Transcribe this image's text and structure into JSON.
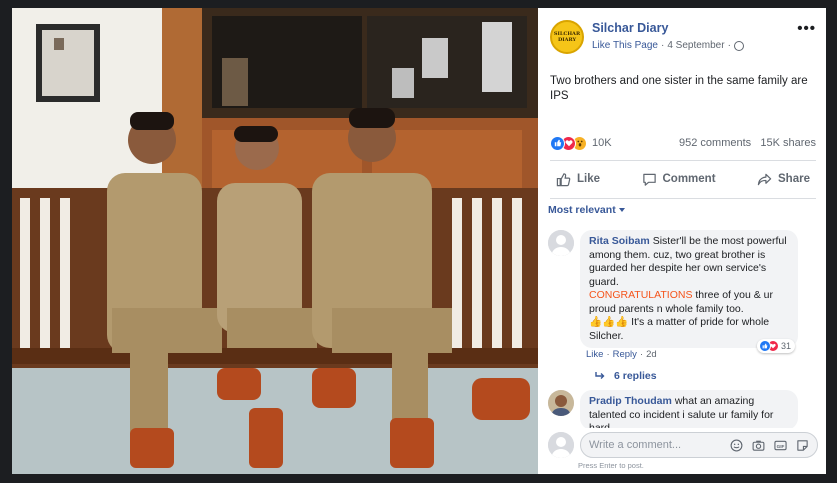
{
  "post": {
    "page_name": "Silchar Diary",
    "logo_text_top": "SILCHAR",
    "logo_text_bottom": "DIARY",
    "like_page": "Like This Page",
    "dot": "·",
    "date": "4 September",
    "dot2": "·",
    "more": "•••",
    "text": "Two brothers and one sister in the same family are IPS",
    "reaction_count": "10K",
    "comments_count": "952 comments",
    "shares_count": "15K shares",
    "actions": {
      "like": "Like",
      "comment": "Comment",
      "share": "Share"
    },
    "sort_label": "Most relevant"
  },
  "comments": [
    {
      "author": "Rita Soibam",
      "text_1": "Sister'll be the most powerful among them. cuz, two great brother is guarded her despite her own service's guard.",
      "highlight": "CONGRATULATIONS",
      "text_2": " three of you & ur proud parents n whole family too.",
      "emoji": "👍👍👍",
      "text_3": " It's a matter of pride for whole Silcher.",
      "like": "Like",
      "reply": "Reply",
      "time": "2d",
      "react_count": "31",
      "replies": "6 replies"
    },
    {
      "author": "Pradip Thoudam",
      "text_1": "what an amazing talented co incident i salute ur family for hard"
    }
  ],
  "composer": {
    "placeholder": "Write a comment...",
    "hint": "Press Enter to post."
  },
  "colors": {
    "page_bg": "#1c1e21",
    "link": "#385898",
    "accent_orange": "#f5541b",
    "like_blue": "#2078f4",
    "love_red": "#f0284a"
  }
}
